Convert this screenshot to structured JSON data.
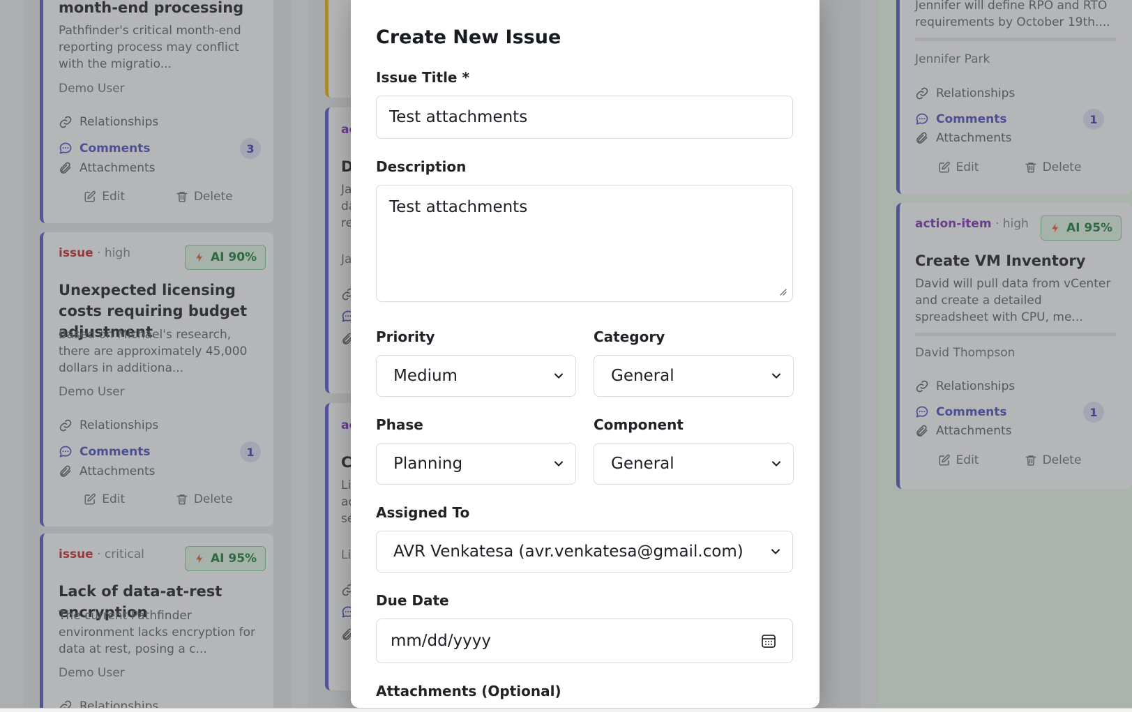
{
  "background_cards": {
    "col1": [
      {
        "title": "month-end processing",
        "description": "Pathfinder's critical month-end reporting process may conflict with the migratio...",
        "owner": "Demo User",
        "relationships_label": "Relationships",
        "comments_label": "Comments",
        "comments_count": "3",
        "attachments_label": "Attachments",
        "edit_label": "Edit",
        "delete_label": "Delete"
      },
      {
        "type": "issue",
        "priority": "· high",
        "ai_badge": "AI 90%",
        "title": "Unexpected licensing costs requiring budget adjustment",
        "description": "Based on Michael's research, there are approximately 45,000 dollars in additiona...",
        "owner": "Demo User",
        "relationships_label": "Relationships",
        "comments_label": "Comments",
        "comments_count": "1",
        "attachments_label": "Attachments",
        "edit_label": "Edit",
        "delete_label": "Delete"
      },
      {
        "type": "issue",
        "priority": "· critical",
        "ai_badge": "AI 95%",
        "title": "Lack of data-at-rest encryption",
        "description": "The current Pathfinder environment lacks encryption for data at rest, posing a c...",
        "owner": "Demo User",
        "relationships_label": "Relationships"
      }
    ],
    "col2_fragments": [
      "ac",
      "D",
      "Ja",
      "da",
      "re",
      "Ja",
      "ac",
      "C",
      "Li",
      "ac",
      "se",
      "Li"
    ],
    "col4": [
      {
        "description": "Jennifer will define RPO and RTO requirements by October 19th....",
        "owner": "Jennifer Park",
        "relationships_label": "Relationships",
        "comments_label": "Comments",
        "comments_count": "1",
        "attachments_label": "Attachments",
        "edit_label": "Edit",
        "delete_label": "Delete"
      },
      {
        "type": "action-item",
        "priority": "· high",
        "ai_badge": "AI 95%",
        "title": "Create VM Inventory",
        "description": "David will pull data from vCenter and create a detailed spreadsheet with CPU, me...",
        "owner": "David Thompson",
        "relationships_label": "Relationships",
        "comments_label": "Comments",
        "comments_count": "1",
        "attachments_label": "Attachments",
        "edit_label": "Edit",
        "delete_label": "Delete"
      }
    ]
  },
  "modal": {
    "title": "Create New Issue",
    "issue_title_label": "Issue Title *",
    "issue_title_value": "Test attachments",
    "description_label": "Description",
    "description_value": "Test attachments",
    "priority_label": "Priority",
    "priority_value": "Medium",
    "category_label": "Category",
    "category_value": "General",
    "phase_label": "Phase",
    "phase_value": "Planning",
    "component_label": "Component",
    "component_value": "General",
    "assigned_label": "Assigned To",
    "assigned_value": "AVR Venkatesa (avr.venkatesa@gmail.com)",
    "due_date_label": "Due Date",
    "due_date_placeholder": "mm/dd/yyyy",
    "attachments_label": "Attachments (Optional)"
  },
  "colors": {
    "accent": "#5358c6",
    "issue": "#c12e2e",
    "action_item": "#7a32b8",
    "ai_badge": "#1c7a3e"
  }
}
